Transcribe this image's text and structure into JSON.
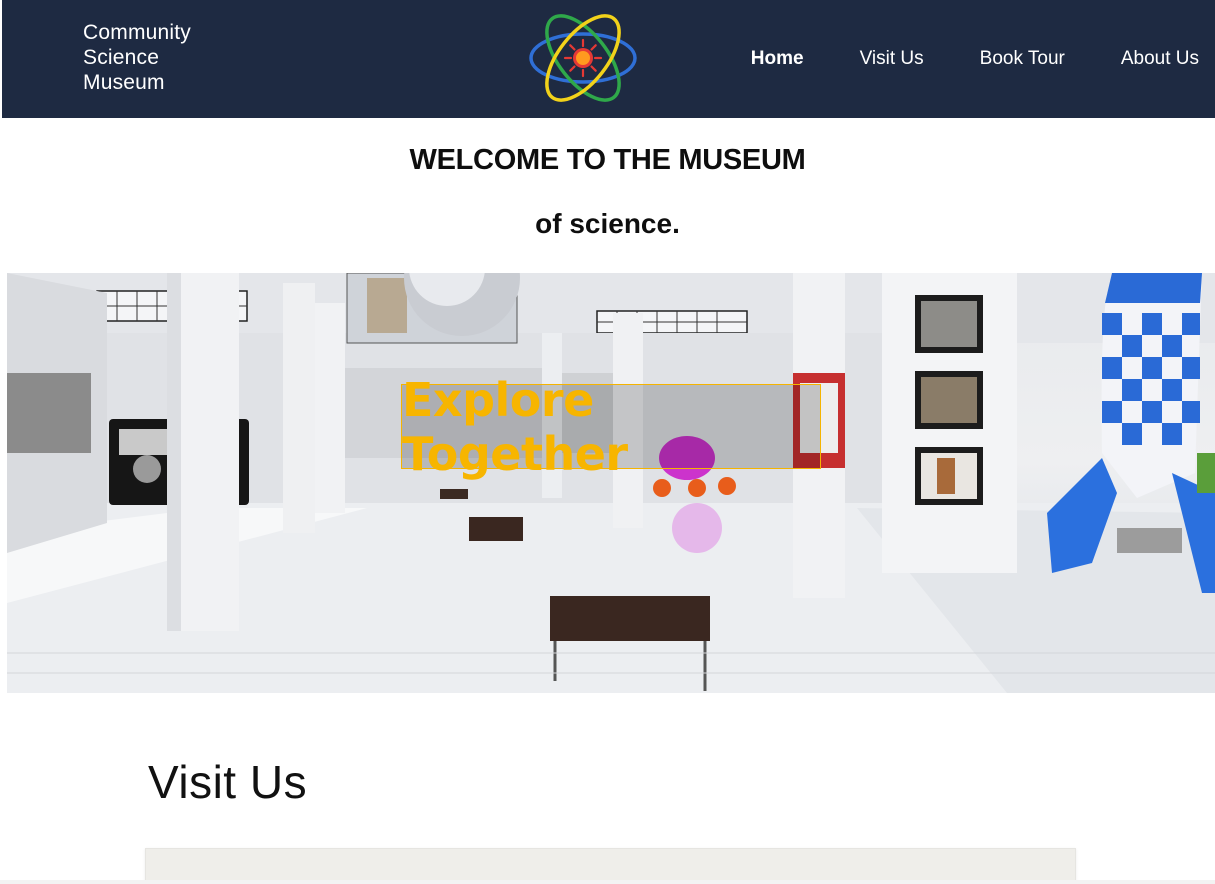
{
  "header": {
    "brand_lines": [
      "Community",
      "Science",
      "Museum"
    ],
    "logo_icon": "atom-logo-icon",
    "nav": [
      {
        "label": "Home",
        "active": true
      },
      {
        "label": "Visit Us",
        "active": false
      },
      {
        "label": "Book Tour",
        "active": false
      },
      {
        "label": "About Us",
        "active": false
      }
    ]
  },
  "welcome": {
    "line1": "WELCOME TO THE MUSEUM",
    "line2": "of science."
  },
  "hero": {
    "cta_label": "Explore Together",
    "cta_color": "#f7b500"
  },
  "visit": {
    "title": "Visit Us"
  },
  "colors": {
    "header_bg": "#1e2a42",
    "accent": "#f7b500"
  }
}
